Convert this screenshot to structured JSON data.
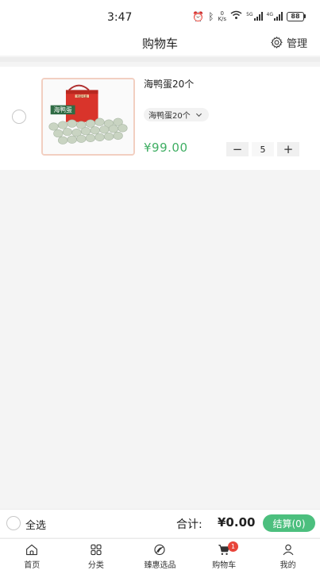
{
  "status_bar": {
    "time": "3:47",
    "network_speed_value": "0",
    "network_speed_unit": "K/s",
    "net_5g": "5G",
    "net_4g": "4G",
    "battery": "88"
  },
  "nav": {
    "title": "购物车",
    "manage_label": "管理"
  },
  "cart": {
    "items": [
      {
        "title": "海鸭蛋20个",
        "spec": "海鸭蛋20个",
        "price": "¥99.00",
        "quantity": "5",
        "image_box_text": "海鸭蛋",
        "image_handle_text": "精品礼盒"
      }
    ]
  },
  "checkout": {
    "select_all_label": "全选",
    "total_label": "合计:",
    "total_amount": "¥0.00",
    "checkout_label": "结算(0)"
  },
  "tabs": [
    {
      "label": "首页",
      "icon": "home-icon"
    },
    {
      "label": "分类",
      "icon": "category-icon"
    },
    {
      "label": "臻惠选品",
      "icon": "selection-icon"
    },
    {
      "label": "购物车",
      "icon": "cart-icon",
      "badge": "1"
    },
    {
      "label": "我的",
      "icon": "user-icon"
    }
  ],
  "colors": {
    "price": "#3fae63",
    "checkout_button": "#4cbf7e",
    "badge": "#e8443a",
    "image_border": "#f2cfc1"
  }
}
